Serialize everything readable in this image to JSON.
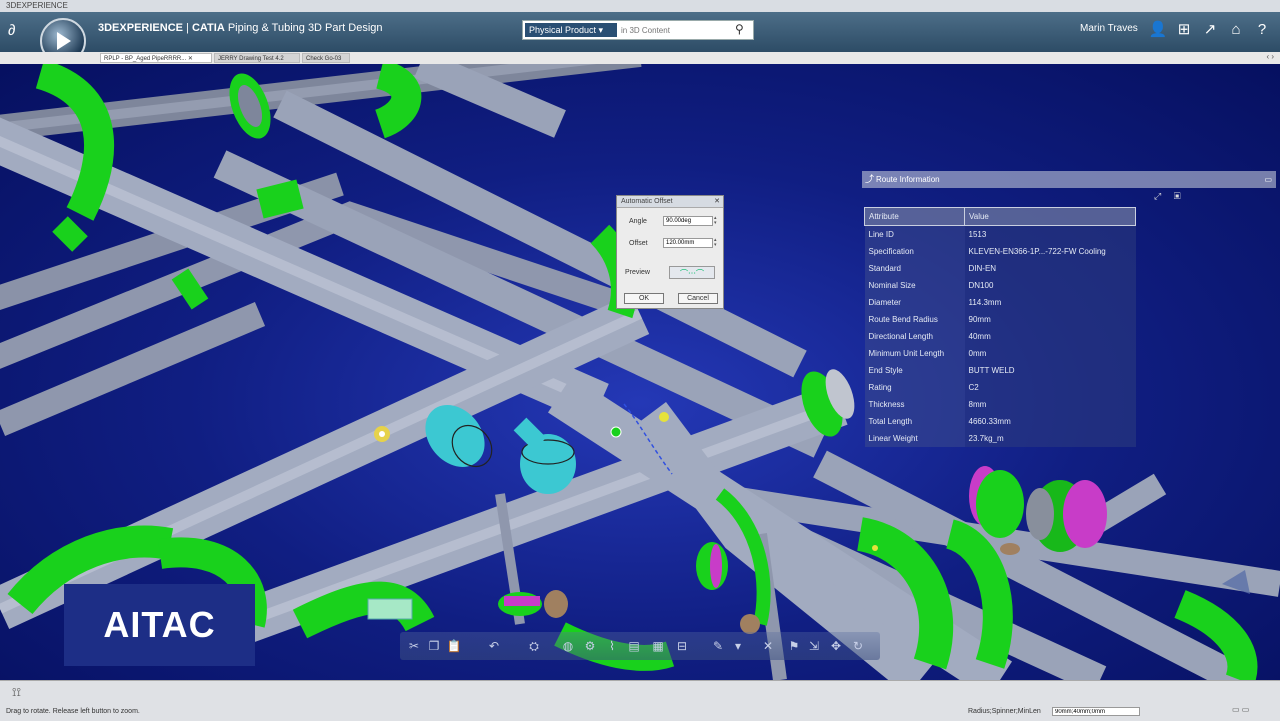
{
  "window": {
    "title": "3DEXPERIENCE"
  },
  "header": {
    "ds_logo": "3DS",
    "brand": "3DEXPERIENCE",
    "app_name": "CATIA",
    "app_subtitle": "Piping & Tubing 3D Part Design",
    "search_scope": "Physical Product",
    "search_placeholder": "in 3D Content",
    "user": "Marin Traves"
  },
  "tabs": [
    {
      "label": "RPLP - BP_Aged PipeRRRR...",
      "active": true
    },
    {
      "label": "JERRY Drawing Test 4.2",
      "active": false
    },
    {
      "label": "Check Go-03",
      "active": false
    }
  ],
  "dialog": {
    "title": "Automatic Offset",
    "angle_label": "Angle",
    "angle_value": "90.00deg",
    "offset_label": "Offset",
    "offset_value": "120.00mm",
    "preview_label": "Preview",
    "ok": "OK",
    "cancel": "Cancel"
  },
  "route_info": {
    "title": "Route Information",
    "columns": [
      "Attribute",
      "Value"
    ],
    "rows": [
      {
        "attr": "Line ID",
        "value": "1513"
      },
      {
        "attr": "Specification",
        "value": "KLEVEN-EN366-1P...-722-FW Cooling"
      },
      {
        "attr": "Standard",
        "value": "DIN-EN"
      },
      {
        "attr": "Nominal Size",
        "value": "DN100"
      },
      {
        "attr": "Diameter",
        "value": "114.3mm"
      },
      {
        "attr": "Route Bend Radius",
        "value": "90mm"
      },
      {
        "attr": "Directional Length",
        "value": "40mm"
      },
      {
        "attr": "Minimum Unit Length",
        "value": "0mm"
      },
      {
        "attr": "End Style",
        "value": "BUTT WELD"
      },
      {
        "attr": "Rating",
        "value": "C2"
      },
      {
        "attr": "Thickness",
        "value": "8mm"
      },
      {
        "attr": "Total Length",
        "value": "4660.33mm"
      },
      {
        "attr": "Linear Weight",
        "value": "23.7kg_m"
      }
    ]
  },
  "logo": {
    "text": "AITAC"
  },
  "status": {
    "message": "Drag to rotate. Release left button to zoom.",
    "right_label": "Radius;Spinner;MinLen",
    "right_value": "90mm;40mm;0mm"
  },
  "colors": {
    "viewport_bg": "#101e82",
    "pipe": "#9aa3b8",
    "fitting": "#19d11c",
    "flange_ring": "#c83cc8",
    "selection": "#3cc8d2"
  }
}
